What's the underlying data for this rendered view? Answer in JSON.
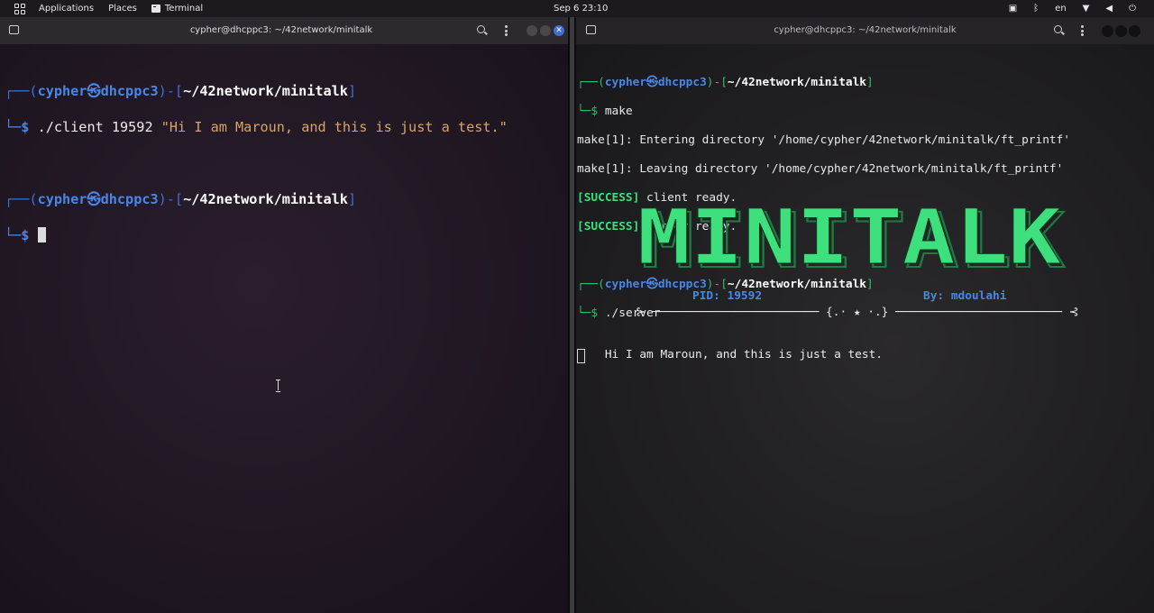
{
  "topbar": {
    "applications": "Applications",
    "places": "Places",
    "terminal": "Terminal",
    "clock": "Sep 6  23:10",
    "lang": "en",
    "icons": [
      "screen-record-icon",
      "bluetooth-icon",
      "wifi-icon",
      "volume-icon",
      "power-icon"
    ]
  },
  "left_window": {
    "title": "cypher@dhcppc3: ~/42network/minitalk",
    "lines": [
      {
        "frame": "┌──(",
        "user": "cypher㉿dhcppc3",
        "frame2": ")-[",
        "dir": "~/42network/minitalk",
        "frame3": "]"
      },
      {
        "prompt": "└─$ ",
        "cmd": "./client",
        "arg": " 19592 ",
        "str": "\"Hi I am Maroun, and this is just a test.\""
      },
      {
        "frame": "┌──(",
        "user": "cypher㉿dhcppc3",
        "frame2": ")-[",
        "dir": "~/42network/minitalk",
        "frame3": "]"
      },
      {
        "prompt": "└─$ "
      }
    ]
  },
  "right_window": {
    "title": "cypher@dhcppc3: ~/42network/minitalk",
    "prompt1": {
      "frame": "┌──(",
      "user": "cypher㉿dhcppc3",
      "frame2": ")-[",
      "dir": "~/42network/minitalk",
      "frame3": "]",
      "prompt": "└─$ ",
      "cmd": "make"
    },
    "output": [
      "make[1]: Entering directory '/home/cypher/42network/minitalk/ft_printf'",
      "make[1]: Leaving directory '/home/cypher/42network/minitalk/ft_printf'"
    ],
    "success_tag": "[SUCCESS]",
    "success_lines": [
      " client ready.",
      " server ready."
    ],
    "prompt2": {
      "frame": "┌──(",
      "user": "cypher㉿dhcppc3",
      "frame2": ")-[",
      "dir": "~/42network/minitalk",
      "frame3": "]",
      "prompt": "└─$ ",
      "cmd": "./server"
    },
    "banner_text": "MINITALK",
    "pid_label": "PID: 19592",
    "by_label": "By: mdoulahi",
    "separator": "⊱ ──────────────────────── {.⋅ ★ ⋅.} ──────────────────────── ⊰",
    "message": "Hi I am Maroun, and this is just a test."
  },
  "colors": {
    "prompt_blue": "#4a86e8",
    "frame_green": "#2fbf6b",
    "success_green": "#3be07a",
    "string_orange": "#d9a564",
    "banner_green": "#3ee07d"
  }
}
